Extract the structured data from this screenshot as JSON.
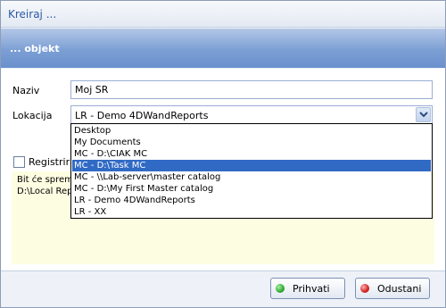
{
  "window": {
    "title": "Kreiraj ..."
  },
  "header": {
    "subtitle": "... objekt"
  },
  "form": {
    "naziv_label": "Naziv",
    "naziv_value": "Moj SR",
    "lokacija_label": "Lokacija",
    "lokacija_value": "LR - Demo 4DWandReports",
    "checkbox_label": "Registrira"
  },
  "info": {
    "line1": "Bit će spreml",
    "line2": "D:\\Local Rep"
  },
  "dropdown": {
    "items": [
      "Desktop",
      "My Documents",
      "MC - D:\\CIAK MC",
      "MC - D:\\Task MC",
      "MC - \\\\Lab-server\\master catalog",
      "MC - D:\\My First Master catalog",
      "LR - Demo 4DWandReports",
      "LR - XX"
    ],
    "selected_index": 3
  },
  "buttons": {
    "accept_label": "Prihvati",
    "cancel_label": "Odustani"
  },
  "colors": {
    "accent": "#316ac5",
    "accept_dot": "#2fa82f",
    "cancel_dot": "#d42020",
    "info_bg": "#fdfde2"
  },
  "icons": {
    "combo_arrow": "chevron-down-icon",
    "accept": "green-dot-icon",
    "cancel": "red-dot-icon"
  }
}
